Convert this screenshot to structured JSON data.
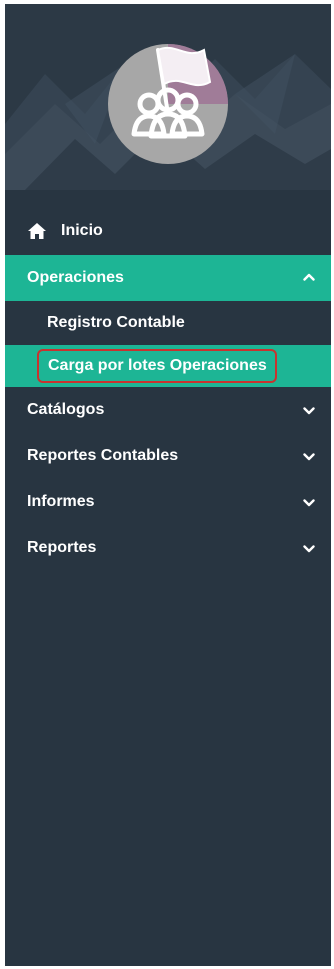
{
  "colors": {
    "sidebar_bg": "#283541",
    "accent": "#1db595",
    "highlight_border": "#c8332f",
    "avatar_bg": "#a7a7a7",
    "avatar_flag": "#9b5a8c"
  },
  "header": {
    "avatar_icon": "group-flag-icon"
  },
  "menu": {
    "home": {
      "label": "Inicio",
      "icon": "home-icon"
    },
    "operaciones": {
      "label": "Operaciones",
      "icon": "chevron-up-icon",
      "expanded": true,
      "children": [
        {
          "label": "Registro Contable"
        },
        {
          "label": "Carga por lotes Operaciones",
          "selected": true
        }
      ]
    },
    "items": [
      {
        "label": "Catálogos",
        "icon": "chevron-down-icon"
      },
      {
        "label": "Reportes Contables",
        "icon": "chevron-down-icon"
      },
      {
        "label": "Informes",
        "icon": "chevron-down-icon"
      },
      {
        "label": "Reportes",
        "icon": "chevron-down-icon"
      }
    ]
  }
}
